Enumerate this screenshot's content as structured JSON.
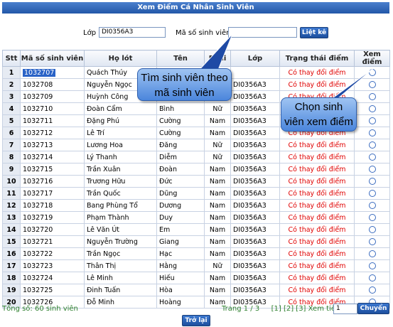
{
  "title": "Xem Điểm Cá Nhân Sinh Viên",
  "filter": {
    "class_label": "Lớp",
    "class_value": "DI0356A3",
    "student_id_label": "Mã số sinh viên",
    "student_id_value": "",
    "list_button": "Liệt kê"
  },
  "columns": [
    "Stt",
    "Mã số sinh viên",
    "Họ lót",
    "Tên",
    "Phái",
    "Lớp",
    "Trạng thái điểm",
    "Xem điểm"
  ],
  "rows": [
    {
      "stt": "1",
      "id": "1032707",
      "ho": "Quách Thúy",
      "ten": "",
      "phai": "",
      "lop": "",
      "status": "Có thay đổi điểm"
    },
    {
      "stt": "2",
      "id": "1032708",
      "ho": "Nguyễn Ngọc",
      "ten": "",
      "phai": "",
      "lop": "DI0356A3",
      "status": "Có thay đổi điểm"
    },
    {
      "stt": "3",
      "id": "1032709",
      "ho": "Huỳnh Công",
      "ten": "",
      "phai": "",
      "lop": "DI0356A3",
      "status": "Có thay đổi điểm"
    },
    {
      "stt": "4",
      "id": "1032710",
      "ho": "Đoàn Cẩm",
      "ten": "Bình",
      "phai": "Nữ",
      "lop": "DI0356A3",
      "status": "Có thay đổi điểm"
    },
    {
      "stt": "5",
      "id": "1032711",
      "ho": "Đặng Phú",
      "ten": "Cường",
      "phai": "Nam",
      "lop": "DI0356A3",
      "status": "Có thay đổi điểm"
    },
    {
      "stt": "6",
      "id": "1032712",
      "ho": "Lê Trí",
      "ten": "Cường",
      "phai": "Nam",
      "lop": "DI0356A3",
      "status": "Có thay đổi điểm"
    },
    {
      "stt": "7",
      "id": "1032713",
      "ho": "Lương Hoa",
      "ten": "Đăng",
      "phai": "Nữ",
      "lop": "DI0356A3",
      "status": "Có thay đổi điểm"
    },
    {
      "stt": "8",
      "id": "1032714",
      "ho": "Lý Thanh",
      "ten": "Diễm",
      "phai": "Nữ",
      "lop": "DI0356A3",
      "status": "Có thay đổi điểm"
    },
    {
      "stt": "9",
      "id": "1032715",
      "ho": "Trần Xuân",
      "ten": "Đoàn",
      "phai": "Nam",
      "lop": "DI0356A3",
      "status": "Có thay đổi điểm"
    },
    {
      "stt": "10",
      "id": "1032716",
      "ho": "Trương Hữu",
      "ten": "Đức",
      "phai": "Nam",
      "lop": "DI0356A3",
      "status": "Có thay đổi điểm"
    },
    {
      "stt": "11",
      "id": "1032717",
      "ho": "Trần Quốc",
      "ten": "Dũng",
      "phai": "Nam",
      "lop": "DI0356A3",
      "status": "Có thay đổi điểm"
    },
    {
      "stt": "12",
      "id": "1032718",
      "ho": "Bang Phùng Tổ",
      "ten": "Dương",
      "phai": "Nam",
      "lop": "DI0356A3",
      "status": "Có thay đổi điểm"
    },
    {
      "stt": "13",
      "id": "1032719",
      "ho": "Phạm Thành",
      "ten": "Duy",
      "phai": "Nam",
      "lop": "DI0356A3",
      "status": "Có thay đổi điểm"
    },
    {
      "stt": "14",
      "id": "1032720",
      "ho": "Lê Văn Út",
      "ten": "Em",
      "phai": "Nam",
      "lop": "DI0356A3",
      "status": "Có thay đổi điểm"
    },
    {
      "stt": "15",
      "id": "1032721",
      "ho": "Nguyễn Trường",
      "ten": "Giang",
      "phai": "Nam",
      "lop": "DI0356A3",
      "status": "Có thay đổi điểm"
    },
    {
      "stt": "16",
      "id": "1032722",
      "ho": "Trần Ngọc",
      "ten": "Hạc",
      "phai": "Nam",
      "lop": "DI0356A3",
      "status": "Có thay đổi điểm"
    },
    {
      "stt": "17",
      "id": "1032723",
      "ho": "Thân Thị",
      "ten": "Hằng",
      "phai": "Nữ",
      "lop": "DI0356A3",
      "status": "Có thay đổi điểm"
    },
    {
      "stt": "18",
      "id": "1032724",
      "ho": "Lê Minh",
      "ten": "Hiếu",
      "phai": "Nam",
      "lop": "DI0356A3",
      "status": "Có thay đổi điểm"
    },
    {
      "stt": "19",
      "id": "1032725",
      "ho": "Đinh Tuấn",
      "ten": "Hòa",
      "phai": "Nam",
      "lop": "DI0356A3",
      "status": "Có thay đổi điểm"
    },
    {
      "stt": "20",
      "id": "1032726",
      "ho": "Đỗ Minh",
      "ten": "Hoàng",
      "phai": "Nam",
      "lop": "DI0356A3",
      "status": "Có thay đổi điểm"
    }
  ],
  "footer": {
    "total": "Tổng số: 60 sinh viên",
    "page_info": "Trang 1 / 3",
    "pages": [
      "[1]",
      "[2]",
      "[3]"
    ],
    "next": "Xem tiếp >>|",
    "page_input": "1",
    "go_button": "Chuyển",
    "back_button": "Trở lại"
  },
  "callouts": {
    "search_line1": "Tìm sinh viên theo",
    "search_line2": "mã sinh viên",
    "select_line1": "Chọn sinh",
    "select_line2": "viên xem điểm"
  },
  "colors": {
    "header_blue": "#2a5fb2",
    "status_red": "#e00000",
    "footer_green": "#2c7f2c",
    "callout_blue": "#6fa0e6"
  }
}
